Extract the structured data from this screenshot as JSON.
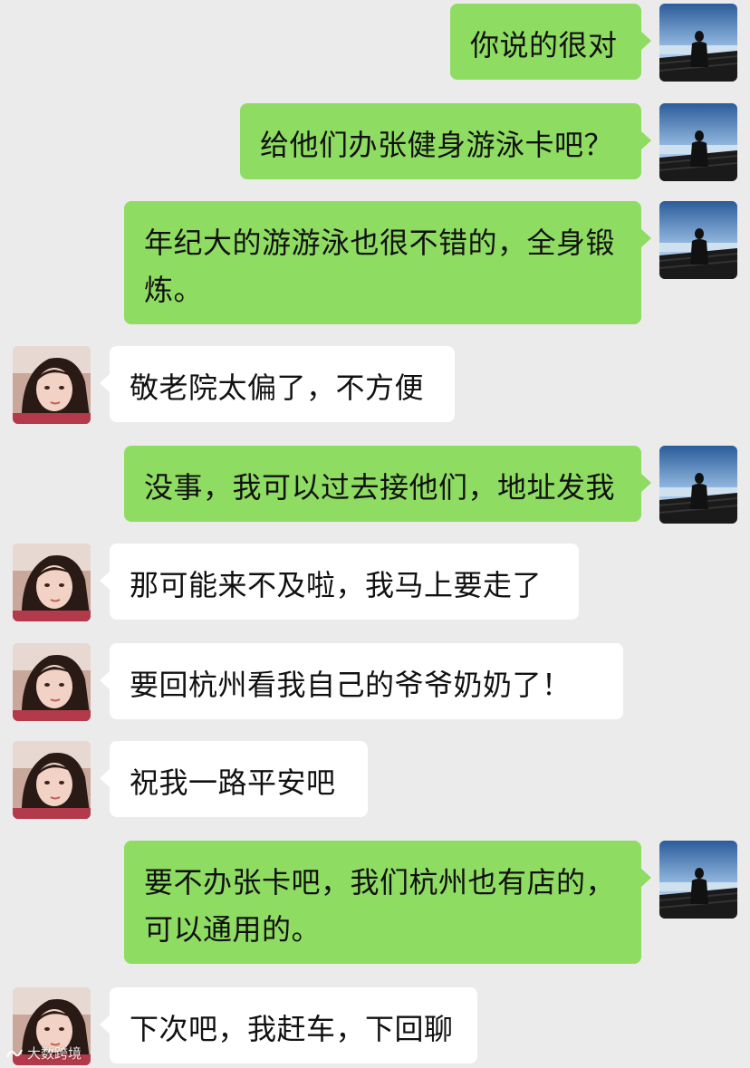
{
  "messages": [
    {
      "from": "self",
      "text": "你说的很对"
    },
    {
      "from": "self",
      "text": "给他们办张健身游泳卡吧？"
    },
    {
      "from": "self",
      "text": "年纪大的游游泳也很不错的，全身锻炼。"
    },
    {
      "from": "other",
      "text": "敬老院太偏了，不方便"
    },
    {
      "from": "self",
      "text": "没事，我可以过去接他们，地址发我"
    },
    {
      "from": "other",
      "text": "那可能来不及啦，我马上要走了"
    },
    {
      "from": "other",
      "text": "要回杭州看我自己的爷爷奶奶了！"
    },
    {
      "from": "other",
      "text": "祝我一路平安吧"
    },
    {
      "from": "self",
      "text": "要不办张卡吧，我们杭州也有店的，可以通用的。"
    },
    {
      "from": "other",
      "text": "下次吧，我赶车，下回聊"
    }
  ],
  "watermark": {
    "text": "大数跨境",
    "icon": "brand-logo-icon"
  },
  "colors": {
    "background": "#ebebeb",
    "sent_bubble": "#8fdc63",
    "received_bubble": "#ffffff",
    "text": "#111111"
  },
  "avatars": {
    "self": "silhouette-by-sea-avatar",
    "other": "woman-portrait-avatar"
  }
}
